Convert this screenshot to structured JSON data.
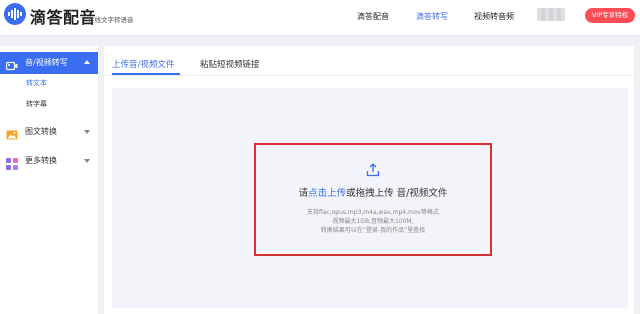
{
  "header": {
    "app_name": "滴答配音",
    "slogan": "在线文字转语音",
    "nav": [
      {
        "label": "滴答配音",
        "active": false
      },
      {
        "label": "滴答转写",
        "active": true
      },
      {
        "label": "视频转音频",
        "active": false
      }
    ],
    "vip_button": "VIP专享特权"
  },
  "sidebar": {
    "groups": [
      {
        "label": "音/视频转写",
        "icon": "video-camera-icon",
        "expanded": true,
        "items": [
          {
            "label": "转文本",
            "active": true
          },
          {
            "label": "转字幕",
            "active": false
          }
        ]
      },
      {
        "label": "图文转换",
        "icon": "image-icon",
        "expanded": false
      },
      {
        "label": "更多转换",
        "icon": "apps-grid-icon",
        "expanded": false
      }
    ]
  },
  "main": {
    "tabs": [
      {
        "label": "上传音/视频文件",
        "active": true
      },
      {
        "label": "粘贴短视频链接",
        "active": false
      }
    ],
    "upload": {
      "prefix": "请",
      "link": "点击上传",
      "suffix": "或拖拽上传 音/视频文件",
      "hints": [
        "支持flac,opus,mp3,m4a,wav,mp4,mov等格式",
        "视频最大1GB,音频最大100M,",
        "转换结果可以在“登录-我的作品”里查找"
      ]
    }
  },
  "colors": {
    "accent": "#3a6df0",
    "vip": "#ff4d55",
    "highlight_border": "#d83030"
  }
}
